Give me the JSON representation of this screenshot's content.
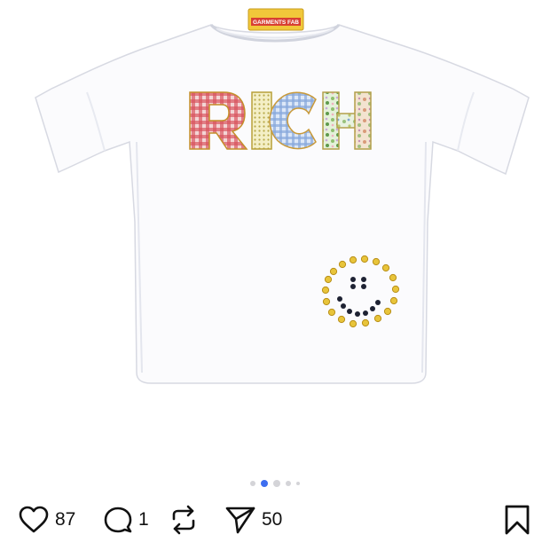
{
  "post": {
    "image_alt": "White t-shirt with patchwork RICH lettering and a stud smiley face",
    "shirt_text": "RICH",
    "label_text": "GARMENTS FAB"
  },
  "carousel": {
    "count": 5,
    "active_index": 1,
    "active_color": "#3d6ef0"
  },
  "actions": {
    "like_count": "87",
    "comment_count": "1",
    "share_count": "50"
  }
}
